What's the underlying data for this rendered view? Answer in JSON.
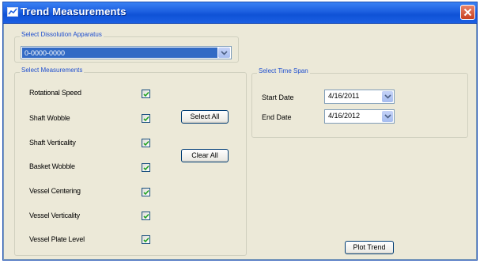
{
  "window": {
    "title": "Trend Measurements"
  },
  "apparatus": {
    "group_label": "Select Dissolution Apparatus",
    "selected_value": "0-0000-0000"
  },
  "measurements": {
    "group_label": "Select Measurements",
    "items": [
      {
        "label": "Rotational Speed",
        "checked": true
      },
      {
        "label": "Shaft Wobble",
        "checked": true
      },
      {
        "label": "Shaft Verticality",
        "checked": true
      },
      {
        "label": "Basket Wobble",
        "checked": true
      },
      {
        "label": "Vessel Centering",
        "checked": true
      },
      {
        "label": "Vessel Verticality",
        "checked": true
      },
      {
        "label": "Vessel Plate Level",
        "checked": true
      }
    ],
    "select_all_label": "Select All",
    "clear_all_label": "Clear All"
  },
  "time_span": {
    "group_label": "Select Time Span",
    "start_label": "Start Date",
    "start_value": "4/16/2011",
    "end_label": "End Date",
    "end_value": "4/16/2012"
  },
  "actions": {
    "plot_trend_label": "Plot Trend"
  },
  "colors": {
    "titlebar": "#0f52d6",
    "dialog_bg": "#ece9d8",
    "group_label": "#1f4fcf",
    "selection": "#316ac5",
    "close_button": "#c8401f",
    "checkmark": "#21a121"
  }
}
